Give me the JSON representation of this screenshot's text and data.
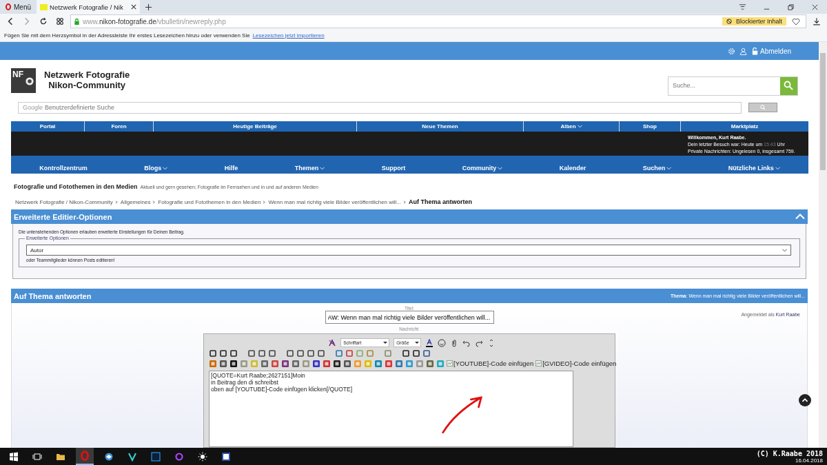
{
  "browser": {
    "menu_label": "Menü",
    "tabs": [
      {
        "label": "Netzwerk Fotografie / Nik",
        "selected": true
      }
    ],
    "url": {
      "prefix": "www.",
      "domain": "nikon-fotografie.de",
      "path": "/vbulletin/newreply.php"
    },
    "blocked_badge": "Blockierter Inhalt",
    "bookmark_hint": {
      "text": "Fügen Sie mit dem Herzsymbol in der Adressleiste Ihr erstes Lesezeichen hinzu oder verwenden Sie",
      "link": "Lesezeichen jetzt importieren"
    }
  },
  "site_header": {
    "logout": "Abmelden",
    "logo_badge": "NF",
    "site_title": [
      "Netzwerk Fotografie",
      "Nikon-Community"
    ],
    "search": {
      "placeholder": "Suche..."
    },
    "google_search": {
      "brand": "Google",
      "placeholder": "Benutzerdefinierte Suche"
    }
  },
  "nav_top": [
    {
      "label": "Portal",
      "dropdown": false
    },
    {
      "label": "Foren",
      "dropdown": false
    },
    {
      "label": "Heutige Beiträge",
      "dropdown": false
    },
    {
      "label": "Neue Themen",
      "dropdown": false
    },
    {
      "label": "Alben",
      "dropdown": true
    },
    {
      "label": "Shop",
      "dropdown": false
    },
    {
      "label": "Marktplatz",
      "dropdown": false
    }
  ],
  "welcome": {
    "greeting": "Willkommen, Kurt Raabe.",
    "last_visit": "Dein letzter Besuch war: Heute um",
    "time": "15:43",
    "time_unit": "Uhr",
    "messages": "Private Nachrichten: Ungelesen 0, insgesamt 759."
  },
  "nav_main": [
    {
      "label": "Kontrollzentrum",
      "dropdown": false
    },
    {
      "label": "Blogs",
      "dropdown": true
    },
    {
      "label": "Hilfe",
      "dropdown": false
    },
    {
      "label": "Themen",
      "dropdown": true
    },
    {
      "label": "Support",
      "dropdown": false
    },
    {
      "label": "Community",
      "dropdown": true
    },
    {
      "label": "Kalender",
      "dropdown": false
    },
    {
      "label": "Suchen",
      "dropdown": true
    },
    {
      "label": "Nützliche Links",
      "dropdown": true
    }
  ],
  "forum": {
    "title": "Fotografie und Fotothemen in den Medien",
    "description": "Aktuell und gern gesehen; Fotografie im Fernsehen und in und auf anderen Medien"
  },
  "breadcrumb": {
    "items": [
      "Netzwerk Fotografie / Nikon-Community",
      "Allgemeines",
      "Fotografie und Fotothemen in den Medien",
      "Wenn man mal richtig viele Bilder veröffentlichen will..."
    ],
    "current": "Auf Thema antworten"
  },
  "advanced_options": {
    "title": "Erweiterte Editier-Optionen",
    "expanded": true,
    "intro": "Die untenstehenden Optionen erlauben erweiterte Einstellungen für Deinen Beitrag.",
    "legend": "Erweiterte Optionen",
    "select_value": "Autor",
    "note": "oder Teammitglieder können Posts editieren!"
  },
  "reply": {
    "title": "Auf Thema antworten",
    "thema": "**Thema**: Wenn man mal richtig viele Bilder veröffentlichen will...",
    "logged_in_label": "Angemeldet als",
    "logged_in_user": "Kurt Raabe",
    "title_label": "Titel:",
    "title_value": "AW: Wenn man mal richtig viele Bilder veröffentlichen will...",
    "message_label": "Nachricht:",
    "font_select": "Schriftart",
    "size_select": "Größe",
    "youtube_button": "[YOUTUBE]-Code einfügen",
    "gvideo_button": "[GVIDEO]-Code einfügen",
    "message_lines": [
      "[QUOTE=Kurt Raabe;2627151]Moin",
      "in Beitrag den di schreibst",
      "oben auf [YOUTUBE]-Code einfügen klicken[/QUOTE]"
    ]
  },
  "taskbar": {
    "date": "16.04.2018",
    "copyright": "(C) K.Raabe 2018"
  }
}
